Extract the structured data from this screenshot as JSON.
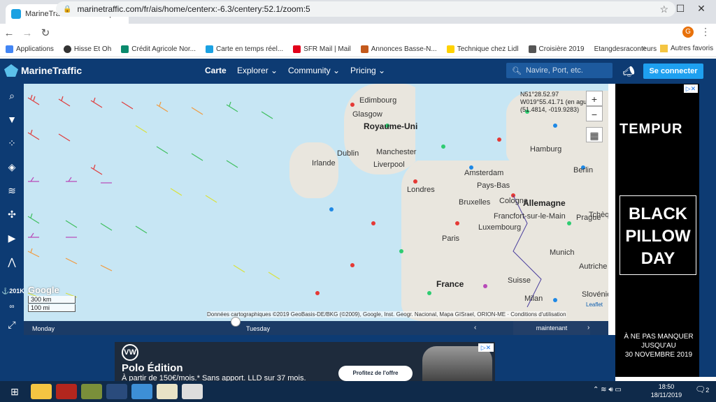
{
  "browser": {
    "tab_title": "MarineTraffic: Global Ship Tracking",
    "url": "marinetraffic.com/fr/ais/home/centerx:-6.3/centery:52.1/zoom:5",
    "avatar_letter": "G",
    "bookmarks": [
      "Applications",
      "Hisse Et Oh",
      "Crédit Agricole Nor...",
      "Carte en temps réel...",
      "SFR Mail | Mail",
      "Annonces Basse-N...",
      "Technique chez Lidl",
      "Croisière 2019",
      "Etangdesraconteurs"
    ],
    "bookmarks_more": "»",
    "other_favorites": "Autres favoris"
  },
  "header": {
    "logo": "MarineTraffic",
    "nav": [
      "Carte",
      "Explorer",
      "Community",
      "Pricing"
    ],
    "search_placeholder": "Navire, Port, etc.",
    "connect": "Se connecter"
  },
  "toolbar": {
    "icons": [
      "search-icon",
      "filter-icon",
      "layers-dots-icon",
      "stack-icon",
      "weather-icon",
      "route-icon",
      "play-icon",
      "measure-icon"
    ],
    "vessel_count": "201K",
    "infinity": "∞",
    "fullscreen": "⤢"
  },
  "map": {
    "labels": {
      "edinburgh": "Edimbourg",
      "glasgow": "Glasgow",
      "uk": "Royaume-Uni",
      "dublin": "Dublin",
      "ireland": "Irlande",
      "manchester": "Manchester",
      "liverpool": "Liverpool",
      "london": "Londres",
      "amsterdam": "Amsterdam",
      "hamburg": "Hamburg",
      "berlin": "Berlin",
      "paysbas": "Pays-Bas",
      "bruxelles": "Bruxelles",
      "cologne": "Cologne",
      "allemagne": "Allemagne",
      "frankfurt": "Francfort-sur-le-Main",
      "luxembourg": "Luxembourg",
      "prague": "Prague",
      "paris": "Paris",
      "munich": "Munich",
      "france": "France",
      "suisse": "Suisse",
      "autriche": "Autriche",
      "milan": "Milan",
      "slovenie": "Slovénie",
      "tcheque": "Tchèque"
    },
    "coord_line1": "N51°28.52.97",
    "coord_line2": "W019°55.41.71 (en ague)",
    "coord_line3": "(51.4814, -019.9283)",
    "zoom_in": "+",
    "zoom_out": "−",
    "scale_km": "300 km",
    "scale_mi": "100 mi",
    "google": "Google",
    "attribution": "Données cartographiques ©2019 GeoBasis-DE/BKG (©2009), Google, Inst. Geogr. Nacional, Mapa GISrael, ORION-ME · Conditions d'utilisation",
    "leaflet": "Leaflet"
  },
  "timeline": {
    "day1": "Monday",
    "day2": "Tuesday",
    "now": "maintenant",
    "prev": "‹",
    "next": "›"
  },
  "right_ad": {
    "brand": "TEMPUR",
    "line1": "BLACK",
    "line2": "PILLOW",
    "line3": "DAY",
    "note1": "À NE PAS MANQUER",
    "note2": "JUSQU'AU",
    "note3": "30 NOVEMBRE 2019",
    "close": "▷✕"
  },
  "bottom_ad": {
    "logo": "VW",
    "title": "Polo Édition",
    "subtitle": "À partir de 150€/mois.* Sans apport. LLD sur 37 mois.",
    "cta": "Profitez de l'offre",
    "close": "▷✕"
  },
  "taskbar": {
    "time": "18:50",
    "date": "18/11/2019",
    "notifications": "2"
  },
  "colors": {
    "header": "#0d3b73",
    "sea": "#c7e6f4",
    "accent": "#1ea0f0"
  }
}
